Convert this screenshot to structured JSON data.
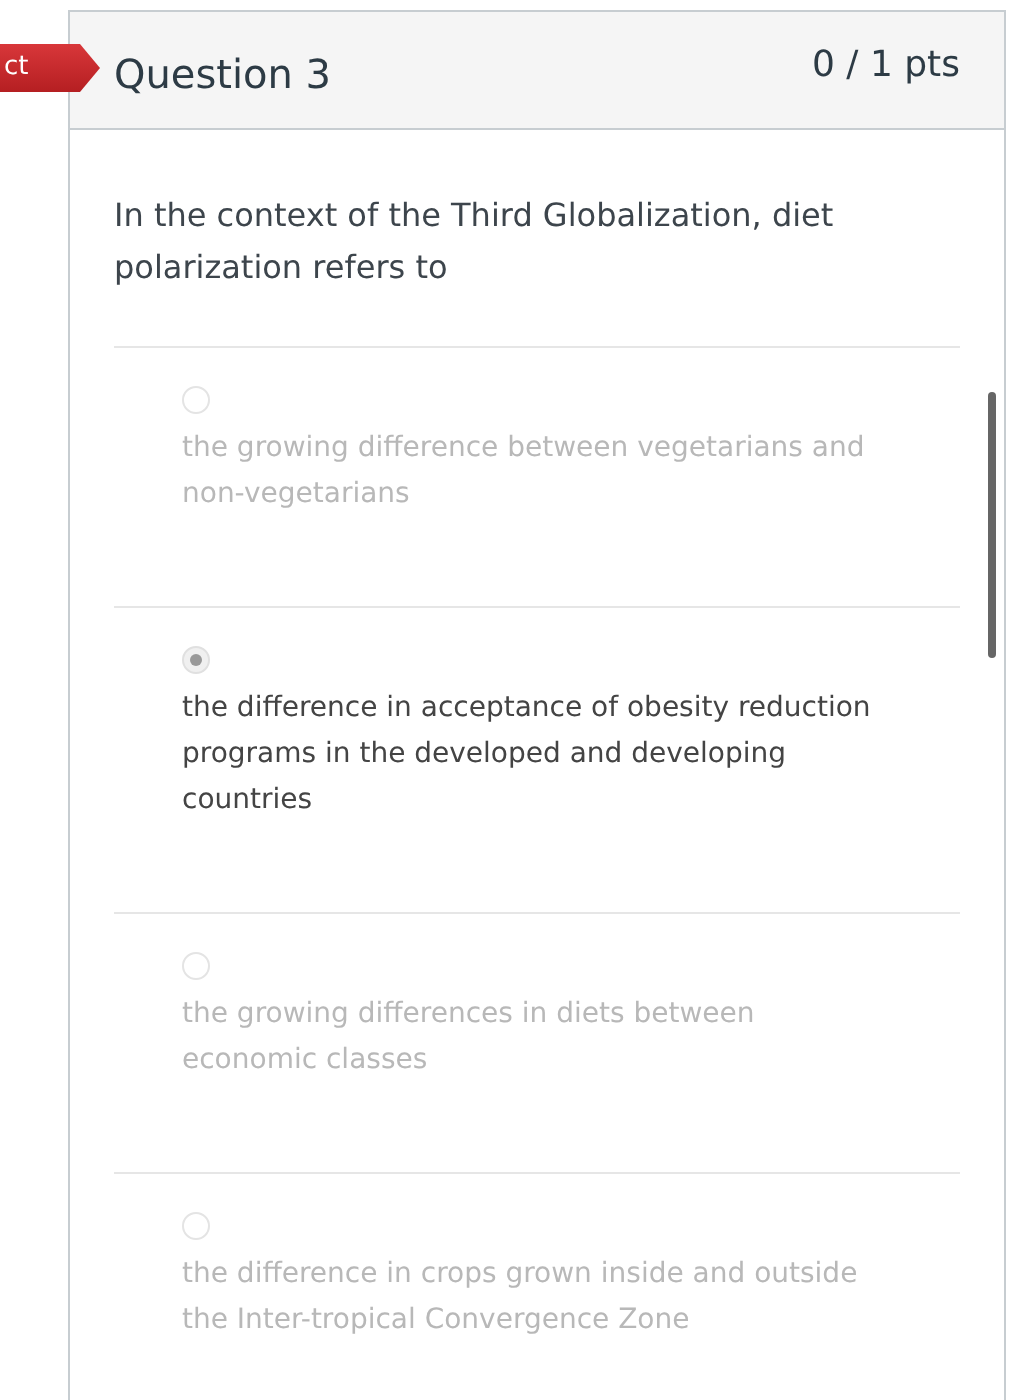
{
  "status_tag": "ct",
  "question": {
    "title": "Question 3",
    "points": "0 / 1 pts",
    "text": "In the context of the Third Globalization, diet polarization refers to"
  },
  "answers": [
    {
      "text": "the growing difference between vegetarians and non-vegetarians",
      "selected": false
    },
    {
      "text": "the difference in acceptance of obesity reduction programs in the developed and developing countries",
      "selected": true
    },
    {
      "text": "the growing differences in diets between economic classes",
      "selected": false
    },
    {
      "text": "the difference in crops grown inside and outside the Inter-tropical Convergence Zone",
      "selected": false
    }
  ]
}
